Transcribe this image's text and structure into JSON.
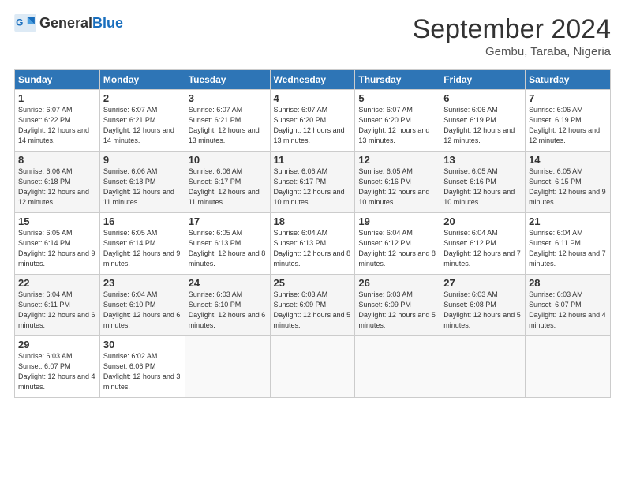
{
  "header": {
    "logo_general": "General",
    "logo_blue": "Blue",
    "month_title": "September 2024",
    "location": "Gembu, Taraba, Nigeria"
  },
  "days_of_week": [
    "Sunday",
    "Monday",
    "Tuesday",
    "Wednesday",
    "Thursday",
    "Friday",
    "Saturday"
  ],
  "weeks": [
    [
      {
        "day": "1",
        "sunrise": "6:07 AM",
        "sunset": "6:22 PM",
        "daylight": "12 hours and 14 minutes."
      },
      {
        "day": "2",
        "sunrise": "6:07 AM",
        "sunset": "6:21 PM",
        "daylight": "12 hours and 14 minutes."
      },
      {
        "day": "3",
        "sunrise": "6:07 AM",
        "sunset": "6:21 PM",
        "daylight": "12 hours and 13 minutes."
      },
      {
        "day": "4",
        "sunrise": "6:07 AM",
        "sunset": "6:20 PM",
        "daylight": "12 hours and 13 minutes."
      },
      {
        "day": "5",
        "sunrise": "6:07 AM",
        "sunset": "6:20 PM",
        "daylight": "12 hours and 13 minutes."
      },
      {
        "day": "6",
        "sunrise": "6:06 AM",
        "sunset": "6:19 PM",
        "daylight": "12 hours and 12 minutes."
      },
      {
        "day": "7",
        "sunrise": "6:06 AM",
        "sunset": "6:19 PM",
        "daylight": "12 hours and 12 minutes."
      }
    ],
    [
      {
        "day": "8",
        "sunrise": "6:06 AM",
        "sunset": "6:18 PM",
        "daylight": "12 hours and 12 minutes."
      },
      {
        "day": "9",
        "sunrise": "6:06 AM",
        "sunset": "6:18 PM",
        "daylight": "12 hours and 11 minutes."
      },
      {
        "day": "10",
        "sunrise": "6:06 AM",
        "sunset": "6:17 PM",
        "daylight": "12 hours and 11 minutes."
      },
      {
        "day": "11",
        "sunrise": "6:06 AM",
        "sunset": "6:17 PM",
        "daylight": "12 hours and 10 minutes."
      },
      {
        "day": "12",
        "sunrise": "6:05 AM",
        "sunset": "6:16 PM",
        "daylight": "12 hours and 10 minutes."
      },
      {
        "day": "13",
        "sunrise": "6:05 AM",
        "sunset": "6:16 PM",
        "daylight": "12 hours and 10 minutes."
      },
      {
        "day": "14",
        "sunrise": "6:05 AM",
        "sunset": "6:15 PM",
        "daylight": "12 hours and 9 minutes."
      }
    ],
    [
      {
        "day": "15",
        "sunrise": "6:05 AM",
        "sunset": "6:14 PM",
        "daylight": "12 hours and 9 minutes."
      },
      {
        "day": "16",
        "sunrise": "6:05 AM",
        "sunset": "6:14 PM",
        "daylight": "12 hours and 9 minutes."
      },
      {
        "day": "17",
        "sunrise": "6:05 AM",
        "sunset": "6:13 PM",
        "daylight": "12 hours and 8 minutes."
      },
      {
        "day": "18",
        "sunrise": "6:04 AM",
        "sunset": "6:13 PM",
        "daylight": "12 hours and 8 minutes."
      },
      {
        "day": "19",
        "sunrise": "6:04 AM",
        "sunset": "6:12 PM",
        "daylight": "12 hours and 8 minutes."
      },
      {
        "day": "20",
        "sunrise": "6:04 AM",
        "sunset": "6:12 PM",
        "daylight": "12 hours and 7 minutes."
      },
      {
        "day": "21",
        "sunrise": "6:04 AM",
        "sunset": "6:11 PM",
        "daylight": "12 hours and 7 minutes."
      }
    ],
    [
      {
        "day": "22",
        "sunrise": "6:04 AM",
        "sunset": "6:11 PM",
        "daylight": "12 hours and 6 minutes."
      },
      {
        "day": "23",
        "sunrise": "6:04 AM",
        "sunset": "6:10 PM",
        "daylight": "12 hours and 6 minutes."
      },
      {
        "day": "24",
        "sunrise": "6:03 AM",
        "sunset": "6:10 PM",
        "daylight": "12 hours and 6 minutes."
      },
      {
        "day": "25",
        "sunrise": "6:03 AM",
        "sunset": "6:09 PM",
        "daylight": "12 hours and 5 minutes."
      },
      {
        "day": "26",
        "sunrise": "6:03 AM",
        "sunset": "6:09 PM",
        "daylight": "12 hours and 5 minutes."
      },
      {
        "day": "27",
        "sunrise": "6:03 AM",
        "sunset": "6:08 PM",
        "daylight": "12 hours and 5 minutes."
      },
      {
        "day": "28",
        "sunrise": "6:03 AM",
        "sunset": "6:07 PM",
        "daylight": "12 hours and 4 minutes."
      }
    ],
    [
      {
        "day": "29",
        "sunrise": "6:03 AM",
        "sunset": "6:07 PM",
        "daylight": "12 hours and 4 minutes."
      },
      {
        "day": "30",
        "sunrise": "6:02 AM",
        "sunset": "6:06 PM",
        "daylight": "12 hours and 3 minutes."
      },
      null,
      null,
      null,
      null,
      null
    ]
  ]
}
